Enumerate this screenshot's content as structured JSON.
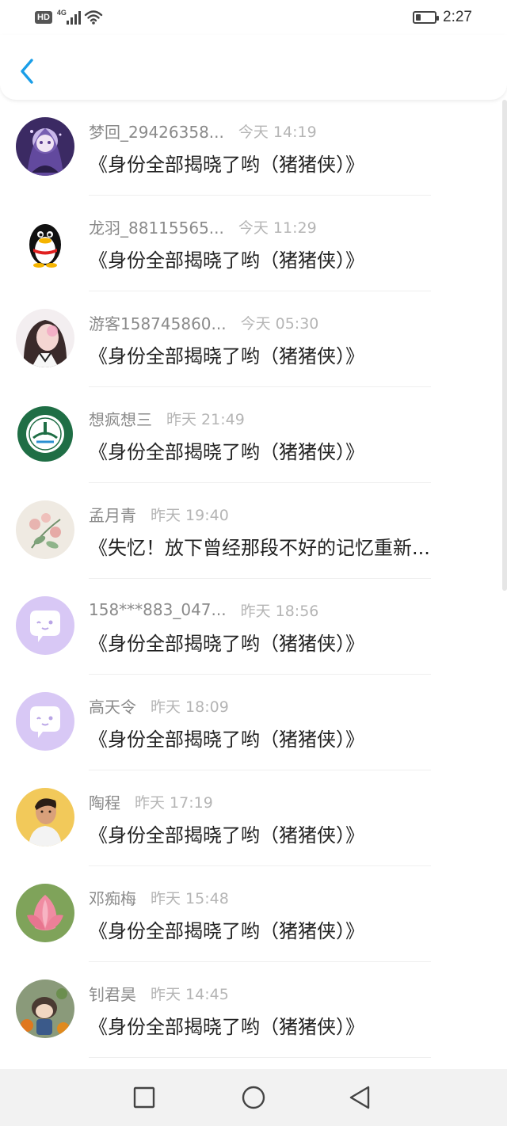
{
  "status_bar": {
    "hd": "HD",
    "network": "4G",
    "time": "2:27",
    "battery_level": 0.25
  },
  "header": {
    "back_icon": "chevron-left-icon",
    "accent_color": "#1a9ee8"
  },
  "messages": [
    {
      "name": "梦回_29426358...",
      "time": "今天 14:19",
      "text": "《身份全部揭晓了哟（猪猪侠）》",
      "avatar": "anime-girl"
    },
    {
      "name": "龙羽_88115565...",
      "time": "今天 11:29",
      "text": "《身份全部揭晓了哟（猪猪侠）》",
      "avatar": "penguin"
    },
    {
      "name": "游客158745860...",
      "time": "今天 05:30",
      "text": "《身份全部揭晓了哟（猪猪侠）》",
      "avatar": "girl-photo"
    },
    {
      "name": "想疯想三",
      "time": "昨天 21:49",
      "text": "《身份全部揭晓了哟（猪猪侠）》",
      "avatar": "school-emblem"
    },
    {
      "name": "孟月青",
      "time": "昨天 19:40",
      "text": "《失忆！放下曾经那段不好的记忆重新...",
      "avatar": "flower-painting"
    },
    {
      "name": "158***883_047...",
      "time": "昨天 18:56",
      "text": "《身份全部揭晓了哟（猪猪侠）》",
      "avatar": "default-chat"
    },
    {
      "name": "高天令",
      "time": "昨天 18:09",
      "text": "《身份全部揭晓了哟（猪猪侠）》",
      "avatar": "default-chat"
    },
    {
      "name": "陶程",
      "time": "昨天 17:19",
      "text": "《身份全部揭晓了哟（猪猪侠）》",
      "avatar": "man-photo"
    },
    {
      "name": "邓痴梅",
      "time": "昨天 15:48",
      "text": "《身份全部揭晓了哟（猪猪侠）》",
      "avatar": "lotus"
    },
    {
      "name": "钊君昊",
      "time": "昨天 14:45",
      "text": "《身份全部揭晓了哟（猪猪侠）》",
      "avatar": "garden-figure"
    }
  ],
  "nav_bar": {
    "recent_icon": "square-icon",
    "home_icon": "circle-icon",
    "back_icon": "triangle-back-icon"
  }
}
